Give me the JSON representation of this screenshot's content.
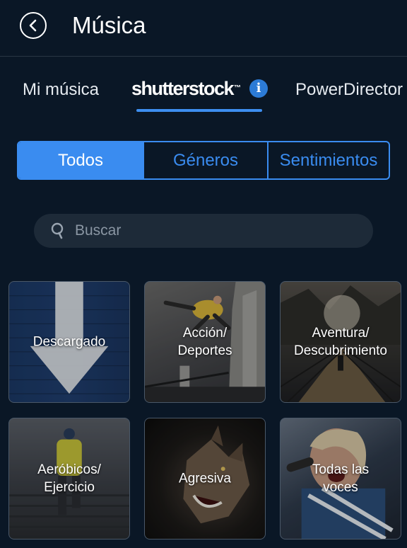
{
  "header": {
    "title": "Música"
  },
  "tabs": [
    {
      "label": "Mi música"
    },
    {
      "label": "shutterstock",
      "info": "i"
    },
    {
      "label": "PowerDirector"
    }
  ],
  "filter": {
    "options": [
      "Todos",
      "Géneros",
      "Sentimientos"
    ],
    "selected": "Todos"
  },
  "search": {
    "placeholder": "Buscar"
  },
  "categories": [
    {
      "label": "Descargado"
    },
    {
      "label": "Acción/\nDeportes"
    },
    {
      "label": "Aventura/\nDescubrimiento"
    },
    {
      "label": "Aeróbicos/\nEjercicio"
    },
    {
      "label": "Agresiva"
    },
    {
      "label": "Todas las\nvoces"
    }
  ],
  "colors": {
    "background": "#0a1726",
    "accent": "#3a8cf0",
    "info_badge": "#2c7bd6"
  }
}
